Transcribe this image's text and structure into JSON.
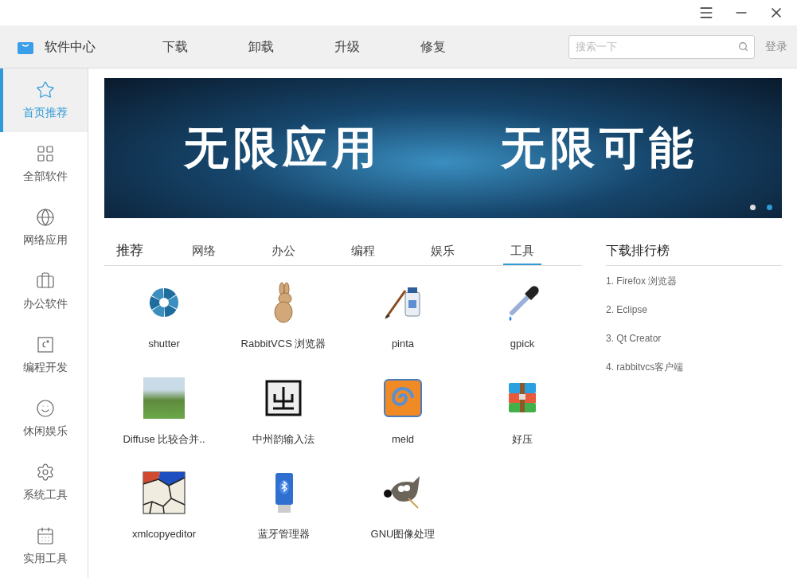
{
  "app": {
    "title": "软件中心"
  },
  "toolbar": {
    "nav": [
      "下载",
      "卸载",
      "升级",
      "修复"
    ],
    "search": {
      "placeholder": "搜索一下"
    },
    "login": "登录"
  },
  "sidebar": {
    "items": [
      {
        "label": "首页推荐",
        "kind": "star",
        "selected": true
      },
      {
        "label": "全部软件",
        "kind": "grid",
        "selected": false
      },
      {
        "label": "网络应用",
        "kind": "globe",
        "selected": false
      },
      {
        "label": "办公软件",
        "kind": "briefcase",
        "selected": false
      },
      {
        "label": "编程开发",
        "kind": "code",
        "selected": false
      },
      {
        "label": "休闲娱乐",
        "kind": "smile",
        "selected": false
      },
      {
        "label": "系统工具",
        "kind": "gear",
        "selected": false
      },
      {
        "label": "实用工具",
        "kind": "calendar",
        "selected": false
      }
    ]
  },
  "banner": {
    "left": "无限应用",
    "right": "无限可能",
    "dots": [
      {
        "selected": false
      },
      {
        "selected": true
      }
    ]
  },
  "tabs": [
    {
      "label": "推荐",
      "kind": "heading",
      "selected": false
    },
    {
      "label": "网络",
      "kind": "tab",
      "selected": false
    },
    {
      "label": "办公",
      "kind": "tab",
      "selected": false
    },
    {
      "label": "编程",
      "kind": "tab",
      "selected": false
    },
    {
      "label": "娱乐",
      "kind": "tab",
      "selected": false
    },
    {
      "label": "工具",
      "kind": "tab",
      "selected": true
    }
  ],
  "apps": [
    {
      "name": "shutter",
      "kind": "shutter"
    },
    {
      "name": "RabbitVCS 浏览器",
      "kind": "rabbit"
    },
    {
      "name": "pinta",
      "kind": "paint"
    },
    {
      "name": "gpick",
      "kind": "dropper"
    },
    {
      "name": "Diffuse 比较合并..",
      "kind": "photo"
    },
    {
      "name": "中州韵输入法",
      "kind": "ime"
    },
    {
      "name": "meld",
      "kind": "meld"
    },
    {
      "name": "好压",
      "kind": "archive"
    },
    {
      "name": "xmlcopyeditor",
      "kind": "xml"
    },
    {
      "name": "蓝牙管理器",
      "kind": "bluetooth"
    },
    {
      "name": "GNU图像处理",
      "kind": "gimp"
    }
  ],
  "ranking": {
    "title": "下载排行榜",
    "items": [
      "1. Firefox 浏览器",
      "2. Eclipse",
      "3. Qt Creator",
      "4. rabbitvcs客户端"
    ]
  }
}
